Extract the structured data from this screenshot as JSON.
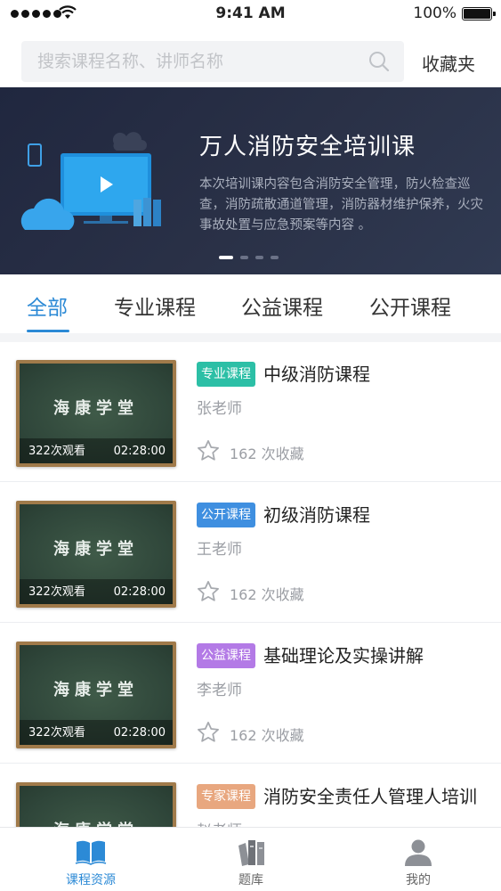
{
  "status_bar": {
    "time": "9:41 AM",
    "battery": "100%"
  },
  "search": {
    "placeholder": "搜索课程名称、讲师名称",
    "value": ""
  },
  "favorites_label": "收藏夹",
  "banner": {
    "title": "万人消防安全培训课",
    "description": "本次培训课内容包含消防安全管理，防火检查巡查，消防疏散通道管理，消防器材维护保养，火灾事故处置与应急预案等内容 。",
    "slide_count": 4,
    "active_slide": 1
  },
  "tabs": [
    {
      "label": "全部",
      "active": true
    },
    {
      "label": "专业课程",
      "active": false
    },
    {
      "label": "公益课程",
      "active": false
    },
    {
      "label": "公开课程",
      "active": false
    }
  ],
  "courses": [
    {
      "thumb_text": "海康学堂",
      "views": "322次观看",
      "duration": "02:28:00",
      "badge": "专业课程",
      "badge_color": "#2cbfa6",
      "title": "中级消防课程",
      "teacher": "张老师",
      "favorites": "162 次收藏"
    },
    {
      "thumb_text": "海康学堂",
      "views": "322次观看",
      "duration": "02:28:00",
      "badge": "公开课程",
      "badge_color": "#3f8fe0",
      "title": "初级消防课程",
      "teacher": "王老师",
      "favorites": "162 次收藏"
    },
    {
      "thumb_text": "海康学堂",
      "views": "322次观看",
      "duration": "02:28:00",
      "badge": "公益课程",
      "badge_color": "#b37ae6",
      "title": "基础理论及实操讲解",
      "teacher": "李老师",
      "favorites": "162 次收藏"
    },
    {
      "thumb_text": "海康学堂",
      "views": "",
      "duration": "",
      "badge": "专家课程",
      "badge_color": "#e8a77f",
      "title": "消防安全责任人管理人培训",
      "teacher": "赵老师",
      "favorites": ""
    }
  ],
  "bottom_nav": [
    {
      "label": "课程资源",
      "icon": "book-icon",
      "active": true
    },
    {
      "label": "题库",
      "icon": "question-bank-icon",
      "active": false
    },
    {
      "label": "我的",
      "icon": "user-icon",
      "active": false
    }
  ],
  "colors": {
    "accent": "#2c8ad6",
    "banner_bg": "#252c42"
  }
}
